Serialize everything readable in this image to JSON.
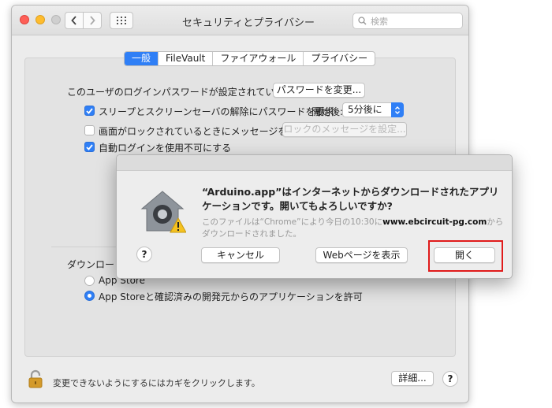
{
  "window": {
    "title": "セキュリティとプライバシー",
    "search_placeholder": "検索"
  },
  "tabs": [
    "一般",
    "FileVault",
    "ファイアウォール",
    "プライバシー"
  ],
  "general": {
    "password_label": "このユーザのログインパスワードが設定されています",
    "change_password_button": "パスワードを変更...",
    "require_password_label": "スリープとスクリーンセーバの解除にパスワードを要求",
    "start_label": "開始後:",
    "start_value": "5分後に",
    "show_message_label": "画面がロックされているときにメッセージを表示",
    "set_message_button": "ロックのメッセージを設定...",
    "disable_autologin_label": "自動ログインを使用不可にする",
    "download_label": "ダウンロード",
    "app_store_option": "App Store",
    "app_store_identified_option": "App Storeと確認済みの開発元からのアプリケーションを許可"
  },
  "footer": {
    "lock_text": "変更できないようにするにはカギをクリックします。",
    "advanced_button": "詳細...",
    "help": "?"
  },
  "dialog": {
    "title": "“Arduino.app”はインターネットからダウンロードされたアプリケーションです。開いてもよろしいですか?",
    "info_prefix": "このファイルは“Chrome”により今日の10:30に",
    "info_site": "www.ebcircuit-pg.com",
    "info_suffix": "からダウンロードされました。",
    "help": "?",
    "cancel_button": "キャンセル",
    "show_web_button": "Webページを表示",
    "open_button": "開く"
  },
  "colors": {
    "accent": "#2f7ff6",
    "highlight": "#e01a1a"
  }
}
